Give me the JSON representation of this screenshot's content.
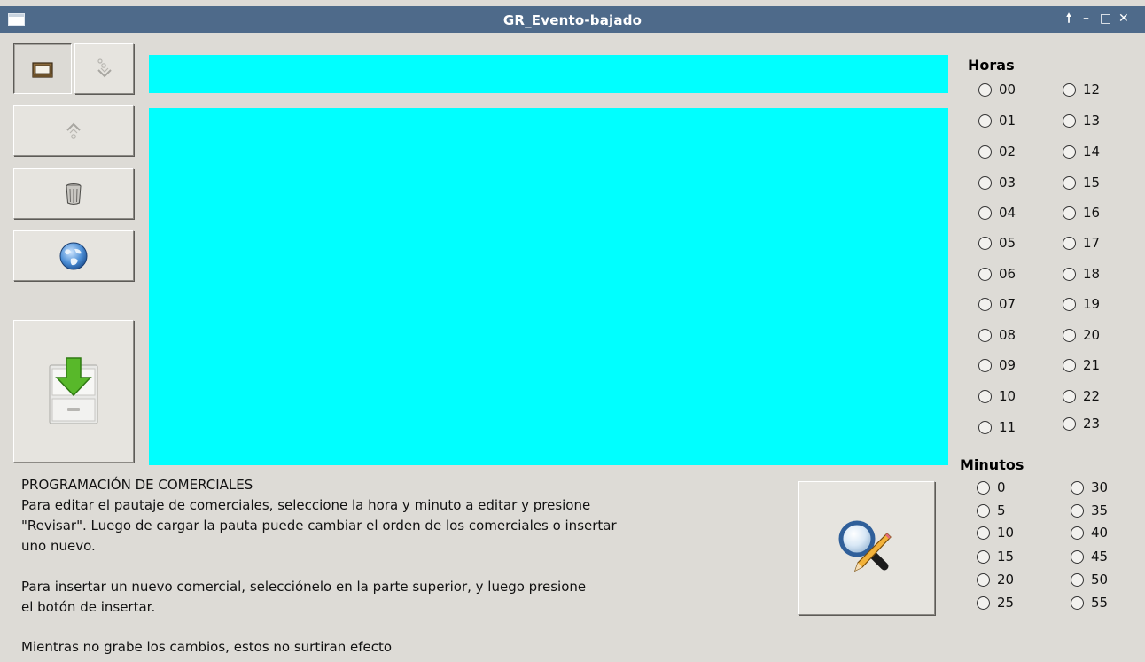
{
  "window": {
    "title": "GR_Evento-bajado",
    "controls": {
      "pin": "🠕",
      "minimize": "–",
      "maximize": "□",
      "close": "✕"
    }
  },
  "toolbar": {
    "buttons": [
      {
        "id": "open",
        "icon": "folder-icon"
      },
      {
        "id": "download-arrow",
        "icon": "down-arrow-icon"
      },
      {
        "id": "move-up",
        "icon": "up-arrow-icon"
      },
      {
        "id": "delete",
        "icon": "trash-icon"
      },
      {
        "id": "web",
        "icon": "globe-icon"
      },
      {
        "id": "save",
        "icon": "save-drawer-icon"
      },
      {
        "id": "review",
        "icon": "magnifier-pencil-icon"
      }
    ]
  },
  "horas": {
    "label": "Horas",
    "left": [
      "00",
      "01",
      "02",
      "03",
      "04",
      "05",
      "06",
      "07",
      "08",
      "09",
      "10",
      "11"
    ],
    "right": [
      "12",
      "13",
      "14",
      "15",
      "16",
      "17",
      "18",
      "19",
      "20",
      "21",
      "22",
      "23"
    ]
  },
  "minutos": {
    "label": "Minutos",
    "left": [
      "0",
      "5",
      "10",
      "15",
      "20",
      "25"
    ],
    "right": [
      "30",
      "35",
      "40",
      "45",
      "50",
      "55"
    ]
  },
  "info": {
    "line1": "PROGRAMACIÓN DE COMERCIALES",
    "line2": "Para editar el pautaje de comerciales, seleccione la hora y minuto a editar y presione",
    "line3": "\"Revisar\". Luego de cargar la pauta puede cambiar el orden de los comerciales o insertar",
    "line4": "uno nuevo.",
    "line5": "Para insertar un nuevo comercial, selecciónelo en la parte superior, y luego presione",
    "line6": "el botón de insertar.",
    "line7": "Mientras no grabe los cambios, estos no surtiran efecto"
  },
  "colors": {
    "titlebar": "#4e6a8a",
    "background": "#dddbd6",
    "panel": "#00ffff"
  }
}
